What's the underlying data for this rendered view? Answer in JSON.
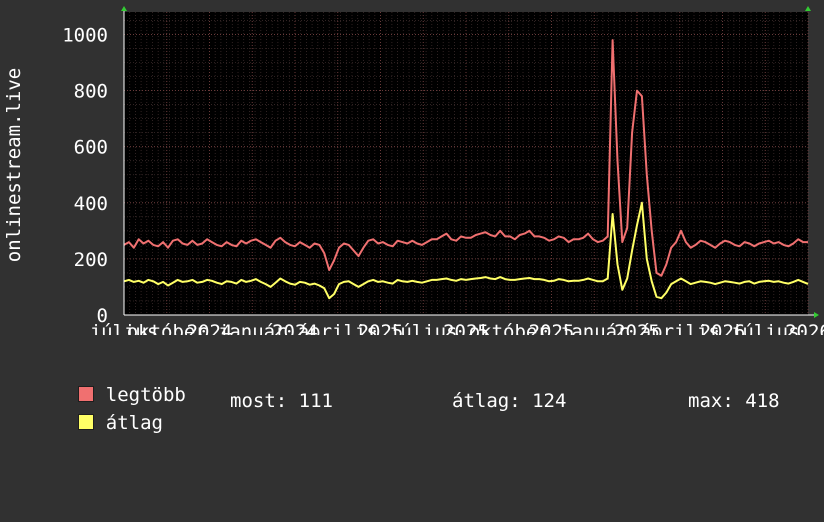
{
  "chart_data": {
    "type": "line",
    "ylabel": "onlinestream.live",
    "ylim": [
      0,
      1080
    ],
    "y_ticks": [
      0,
      200,
      400,
      600,
      800,
      1000
    ],
    "y_tick_labels": [
      "0",
      "200",
      "400",
      "600",
      "800",
      "1000"
    ],
    "x_tick_labels": [
      "július",
      "október",
      "2024",
      "január",
      "2024",
      "április",
      "2025",
      "július",
      "2025",
      "október",
      "2025",
      "január",
      "2025",
      "április",
      "2026",
      "július",
      "2026"
    ],
    "grid": true,
    "series": [
      {
        "name": "legtöbb",
        "color": "#f07070",
        "values": [
          250,
          260,
          240,
          270,
          255,
          265,
          250,
          245,
          260,
          240,
          265,
          270,
          255,
          250,
          265,
          250,
          255,
          270,
          260,
          250,
          245,
          260,
          250,
          245,
          265,
          255,
          265,
          270,
          260,
          250,
          240,
          265,
          275,
          260,
          250,
          245,
          260,
          250,
          240,
          255,
          250,
          220,
          160,
          195,
          240,
          255,
          250,
          230,
          210,
          240,
          265,
          270,
          255,
          260,
          250,
          245,
          265,
          260,
          255,
          265,
          255,
          250,
          260,
          270,
          270,
          280,
          290,
          270,
          265,
          280,
          275,
          275,
          285,
          290,
          295,
          285,
          280,
          300,
          280,
          280,
          270,
          285,
          290,
          300,
          280,
          280,
          275,
          265,
          270,
          280,
          275,
          260,
          270,
          270,
          275,
          290,
          270,
          260,
          265,
          280,
          980,
          550,
          260,
          310,
          650,
          800,
          780,
          500,
          300,
          150,
          140,
          180,
          240,
          260,
          300,
          260,
          240,
          250,
          265,
          260,
          250,
          240,
          255,
          265,
          260,
          250,
          245,
          260,
          255,
          245,
          255,
          260,
          265,
          255,
          260,
          250,
          245,
          255,
          270,
          260,
          260
        ]
      },
      {
        "name": "átlag",
        "color": "#ffff66",
        "values": [
          120,
          125,
          118,
          122,
          115,
          125,
          120,
          110,
          118,
          105,
          115,
          125,
          118,
          120,
          125,
          115,
          118,
          125,
          122,
          115,
          110,
          120,
          118,
          112,
          125,
          118,
          122,
          128,
          118,
          110,
          100,
          115,
          130,
          120,
          112,
          108,
          118,
          115,
          108,
          112,
          105,
          95,
          60,
          75,
          110,
          118,
          120,
          110,
          100,
          110,
          120,
          125,
          118,
          120,
          115,
          112,
          125,
          120,
          118,
          122,
          118,
          115,
          120,
          125,
          125,
          128,
          130,
          125,
          122,
          128,
          125,
          128,
          130,
          132,
          135,
          130,
          128,
          135,
          128,
          125,
          125,
          128,
          130,
          132,
          128,
          128,
          125,
          120,
          122,
          128,
          125,
          120,
          122,
          122,
          125,
          130,
          125,
          120,
          120,
          130,
          360,
          180,
          90,
          130,
          230,
          320,
          400,
          200,
          120,
          65,
          60,
          80,
          110,
          120,
          130,
          120,
          110,
          115,
          120,
          118,
          115,
          110,
          115,
          120,
          118,
          115,
          112,
          118,
          120,
          112,
          118,
          120,
          122,
          118,
          120,
          115,
          112,
          118,
          125,
          118,
          111
        ]
      }
    ]
  },
  "legend": {
    "items": [
      {
        "name": "legtöbb",
        "color": "#f07070"
      },
      {
        "name": "átlag",
        "color": "#ffff66"
      }
    ],
    "stats": {
      "now": "most: 111",
      "avg": "átlag: 124",
      "max": "max: 418"
    }
  }
}
